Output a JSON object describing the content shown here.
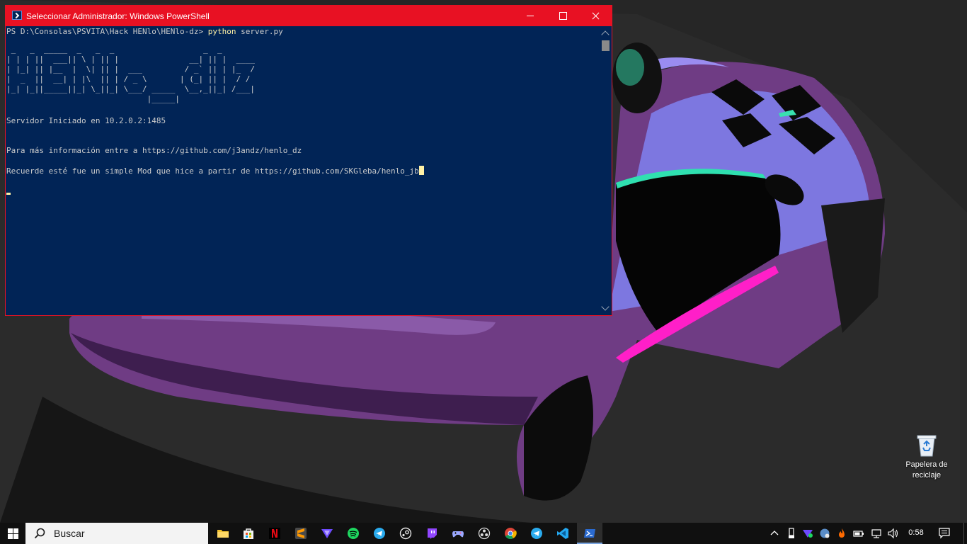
{
  "window": {
    "title": "Seleccionar Administrador: Windows PowerShell",
    "buttons": {
      "minimize": "minimize",
      "maximize": "maximize",
      "close": "close"
    }
  },
  "console": {
    "prompt": "PS D:\\Consolas\\PSVITA\\Hack HENlo\\HENlo-dz> ",
    "command": "python",
    "command_args": " server.py",
    "banner": " _   _  _____  _   _  _                   _  _         \n| | | ||  ___|| \\ | || |               __| || |  ____  \n| |_| || |__  |  \\| || |  ___         / _` || | |_  /  \n|  _  ||  __| | |\\  || | / _ \\       | (_| || |  / /   \n|_| |_||_____||_| \\_||_| \\___/ _____  \\__,_||_| /___|  \n                              |_____|                   ",
    "server_line": "Servidor Iniciado en 10.2.0.2:1485",
    "info_line": "Para más información entre a https://github.com/j3andz/henlo_dz",
    "credit_line": "Recuerde esté fue un simple Mod que hice a partir de https://github.com/SKGleba/henlo_jb"
  },
  "desktop": {
    "recycle_bin_label": "Papelera de reciclaje"
  },
  "taskbar": {
    "search_placeholder": "Buscar",
    "pinned": [
      "file-explorer-icon",
      "microsoft-store-icon",
      "netflix-icon",
      "sublime-text-icon",
      "proton-vpn-icon",
      "spotify-icon",
      "telegram-icon",
      "steam-icon",
      "twitch-icon",
      "game-controller-icon",
      "obs-icon",
      "chrome-icon",
      "telegram-icon",
      "vscode-icon",
      "powershell-icon"
    ],
    "clock": "0:58"
  },
  "colors": {
    "titlebar": "#e81123",
    "console_bg": "#012456",
    "console_text": "#cccccc",
    "command_text": "#fff1a6",
    "taskbar_bg": "#101010"
  }
}
